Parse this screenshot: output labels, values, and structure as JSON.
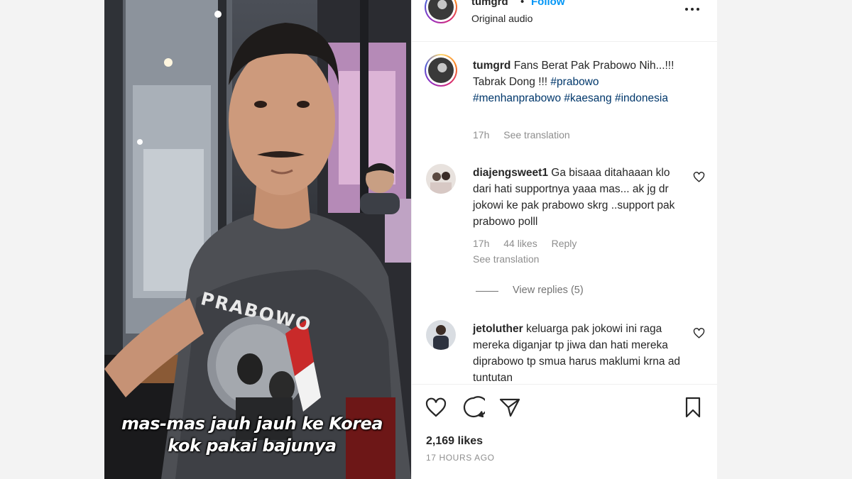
{
  "post": {
    "username": "tumgrd",
    "separator": "•",
    "follow_label": "Follow",
    "audio_label": "Original audio"
  },
  "caption": {
    "username": "tumgrd",
    "text_plain": "Fans Berat Pak Prabowo Nih...!!! Tabrak Dong !!!",
    "hashtags": [
      "#prabowo",
      "#menhanprabowo",
      "#kaesang",
      "#indonesia"
    ],
    "time": "17h",
    "see_translation": "See translation"
  },
  "comments": [
    {
      "username": "diajengsweet1",
      "text": "Ga bisaaa ditahaaan klo dari hati supportnya yaaa mas... ak jg dr jokowi ke pak prabowo skrg ..support pak prabowo polll",
      "time": "17h",
      "likes": "44 likes",
      "reply": "Reply",
      "see_translation": "See translation",
      "view_replies": "View replies (5)"
    },
    {
      "username": "jetoluther",
      "text": "keluarga pak jokowi ini raga mereka diganjar tp jiwa dan hati mereka diprabowo tp smua harus maklumi krna ad tuntutan"
    }
  ],
  "stats": {
    "likes": "2,169 likes",
    "time_ago": "17 HOURS AGO"
  },
  "video": {
    "subtitle_line1": "mas-mas jauh jauh ke Korea",
    "subtitle_line2": "kok pakai bajunya",
    "shirt_print": "PRABOWO"
  },
  "colors": {
    "accent_blue": "#0095f6",
    "hashtag": "#00376b",
    "muted": "#8e8e8e",
    "text": "#262626"
  }
}
